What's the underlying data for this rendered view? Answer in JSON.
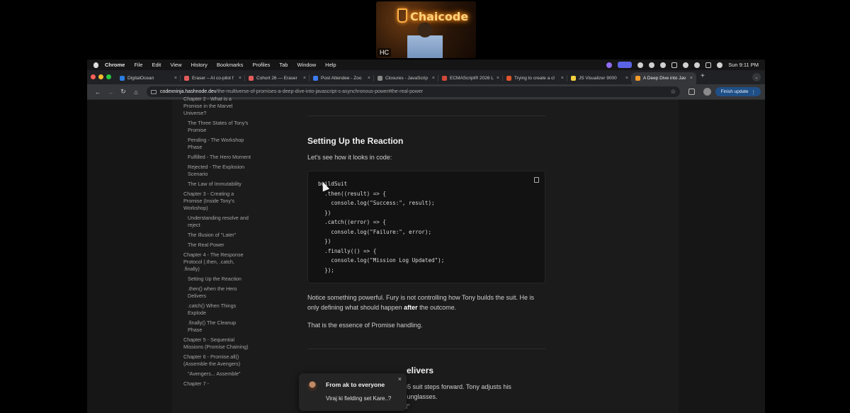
{
  "webcam": {
    "sign": "Chaicode",
    "initials": "HC"
  },
  "menubar": {
    "app": "Chrome",
    "items": [
      "File",
      "Edit",
      "View",
      "History",
      "Bookmarks",
      "Profiles",
      "Tab",
      "Window",
      "Help"
    ],
    "clock": "Sun 9:11 PM"
  },
  "tabs": [
    {
      "title": "DigitalOcean",
      "favicon_color": "#2a7de1"
    },
    {
      "title": "Eraser – AI co-pilot f",
      "favicon_color": "#e25b5b"
    },
    {
      "title": "Cohort 26 — Eraser",
      "favicon_color": "#e25b5b"
    },
    {
      "title": "Post Attendee - Zoo",
      "favicon_color": "#3d7bf2"
    },
    {
      "title": "Closures - JavaScrip",
      "favicon_color": "#888888"
    },
    {
      "title": "ECMAScript® 2026 L",
      "favicon_color": "#d24a3a"
    },
    {
      "title": "Trying to create a cl",
      "favicon_color": "#e0552b"
    },
    {
      "title": "JS Visualizer 9000",
      "favicon_color": "#f0d040"
    },
    {
      "title": "A Deep Dive into Jav",
      "favicon_color": "#f29b2a",
      "active": true
    }
  ],
  "address": {
    "host": "codexninja.hashnode.dev",
    "path": "/the-multiverse-of-promises-a-deep-dive-into-javascript-s-asynchronous-power#the-real-power"
  },
  "finish_update": "Finish update",
  "toc": [
    {
      "text": "Chapter 2 - What is a Promise in the Marvel Universe?",
      "level": 0
    },
    {
      "text": "The Three States of Tony's Promise",
      "level": 1
    },
    {
      "text": "Pending - The Workshop Phase",
      "level": 1
    },
    {
      "text": "Fulfilled - The Hero Moment",
      "level": 1
    },
    {
      "text": "Rejected - The Explosion Scenario",
      "level": 1
    },
    {
      "text": "The Law of Immutability",
      "level": 1
    },
    {
      "text": "Chapter 3 - Creating a Promise (Inside Tony's Workshop)",
      "level": 0
    },
    {
      "text": "Understanding resolve and reject",
      "level": 1
    },
    {
      "text": "The Illusion of \"Later\"",
      "level": 1
    },
    {
      "text": "The Real Power",
      "level": 1
    },
    {
      "text": "Chapter 4 - The Response Protocol (.then, .catch, .finally)",
      "level": 0
    },
    {
      "text": "Setting Up the Reaction",
      "level": 1
    },
    {
      "text": ".then() when the Hero Delivers",
      "level": 1
    },
    {
      "text": ".catch() When Things Explode",
      "level": 1
    },
    {
      "text": ".finally() The Cleanup Phase",
      "level": 1
    },
    {
      "text": "Chapter 5 - Sequential Missions (Promise Chaining)",
      "level": 0
    },
    {
      "text": "Chapter 6 - Promise.all() (Assemble the Avengers)",
      "level": 0
    },
    {
      "text": "\"Avengers... Assemble\"",
      "level": 1
    },
    {
      "text": "Chapter 7 -",
      "level": 0
    }
  ],
  "article": {
    "heading": "Setting Up the Reaction",
    "intro": "Let's see how it looks in code:",
    "code_lines": [
      "buildSuit",
      "  .then((result) => {",
      "    console.log(\"Success:\", result);",
      "  })",
      "  .catch((error) => {",
      "    console.log(\"Failure:\", error);",
      "  })",
      "  .finally(() => {",
      "    console.log(\"Mission Log Updated\");",
      "  });"
    ],
    "para1_before": "Notice something powerful. Fury is not controlling how Tony builds the suit. He is only defining what should happen ",
    "para1_bold": "after",
    "para1_after": " the outcome.",
    "para2": "That is the essence of Promise handling.",
    "next_heading_tail": "elivers",
    "next_line_tail": "85 suit steps forward. Tony adjusts his sunglasses.",
    "next_line2_tail": "d\""
  },
  "chat_toast": {
    "from": "From ak to everyone",
    "message": "Viraj ki fielding set Kare..?"
  }
}
